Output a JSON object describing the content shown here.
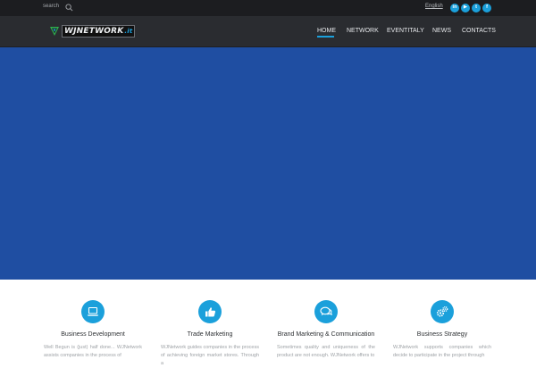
{
  "topbar": {
    "search_label": "search",
    "language": "English",
    "social": [
      {
        "icon": "linkedin-icon",
        "glyph": "in"
      },
      {
        "icon": "youtube-icon",
        "glyph": "▶"
      },
      {
        "icon": "twitter-icon",
        "glyph": "t"
      },
      {
        "icon": "facebook-icon",
        "glyph": "f"
      }
    ]
  },
  "header": {
    "logo_text": "WJNETWORK",
    "logo_suffix": ".it",
    "nav": [
      "HOME",
      "NETWORK",
      "EVENTITALY",
      "NEWS",
      "CONTACTS"
    ],
    "active_nav": "HOME"
  },
  "colors": {
    "accent": "#1ba0db",
    "hero": "#1f4ea2",
    "topbar": "#1c1d20",
    "header": "#2a2c30"
  },
  "services": [
    {
      "icon": "laptop-icon",
      "title": "Business Development",
      "text": "Well Begun is (just) half done... WJNetwork assists companies in the process of"
    },
    {
      "icon": "thumbs-up-icon",
      "title": "Trade Marketing",
      "text": "WJNetwork guides companies in the process of achieving foreign market stores. Through a"
    },
    {
      "icon": "chat-bubbles-icon",
      "title": "Brand Marketing & Communication",
      "text": "Sometimes quality and uniqueness of the product are not enough. WJNetwork offers to"
    },
    {
      "icon": "gears-icon",
      "title": "Business Strategy",
      "text": "WJNetwork supports companies which decide to participate in the project through"
    }
  ]
}
